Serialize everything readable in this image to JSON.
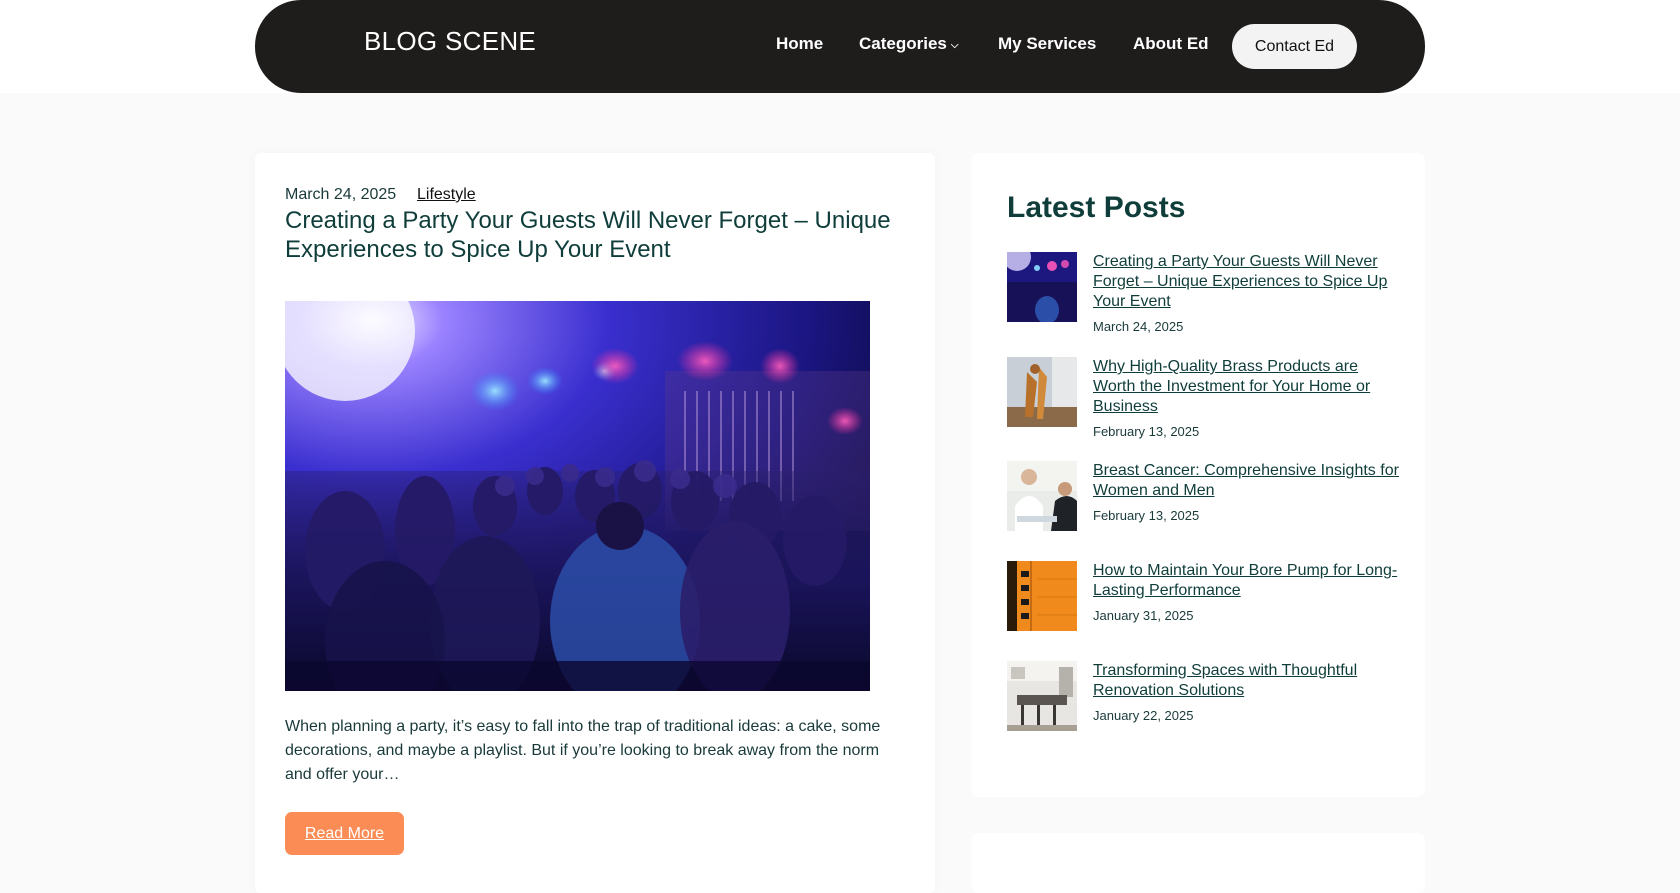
{
  "header": {
    "site_title": "BLOG SCENE",
    "nav": {
      "home": "Home",
      "categories": "Categories",
      "services": "My Services",
      "about": "About Ed"
    },
    "contact_label": "Contact Ed"
  },
  "post": {
    "date": "March 24, 2025",
    "category": "Lifestyle",
    "title": "Creating a Party Your Guests Will Never Forget – Unique Experiences to Spice Up Your Event",
    "excerpt": "When planning a party, it’s easy to fall into the trap of traditional ideas: a cake, some decorations, and maybe a playlist. But if you’re looking to break away from the norm and offer your…",
    "read_more": "Read More"
  },
  "sidebar": {
    "heading": "Latest Posts",
    "posts": [
      {
        "title": "Creating a Party Your Guests Will Never Forget – Unique Experiences to Spice Up Your Event",
        "date": "March 24, 2025"
      },
      {
        "title": "Why High-Quality Brass Products are Worth the Investment for Your Home or Business",
        "date": "February 13, 2025"
      },
      {
        "title": "Breast Cancer: Comprehensive Insights for Women and Men",
        "date": "February 13, 2025"
      },
      {
        "title": "How to Maintain Your Bore Pump for Long-Lasting Performance",
        "date": "January 31, 2025"
      },
      {
        "title": "Transforming Spaces with Thoughtful Renovation Solutions",
        "date": "January 22, 2025"
      }
    ]
  },
  "colors": {
    "header_bg": "#1f1c1c",
    "accent_button": "#fb8c55",
    "heading_text": "#0f3d3a"
  }
}
